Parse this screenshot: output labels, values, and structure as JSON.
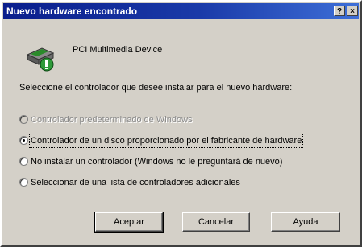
{
  "window": {
    "title": "Nuevo hardware encontrado",
    "help_glyph": "?",
    "close_glyph": "×"
  },
  "device": {
    "name": "PCI Multimedia Device",
    "icon": "hardware-wizard-icon"
  },
  "instruction": "Seleccione el controlador que desee instalar para el nuevo hardware:",
  "options": [
    {
      "label": "Controlador predeterminado de Windows",
      "checked": false,
      "disabled": true
    },
    {
      "label": "Controlador de un disco proporcionado por el fabricante de hardware",
      "checked": true,
      "disabled": false
    },
    {
      "label": "No instalar un controlador (Windows no le preguntará de nuevo)",
      "checked": false,
      "disabled": false
    },
    {
      "label": "Seleccionar de una lista de controladores adicionales",
      "checked": false,
      "disabled": false
    }
  ],
  "buttons": {
    "ok": "Aceptar",
    "cancel": "Cancelar",
    "help": "Ayuda"
  }
}
